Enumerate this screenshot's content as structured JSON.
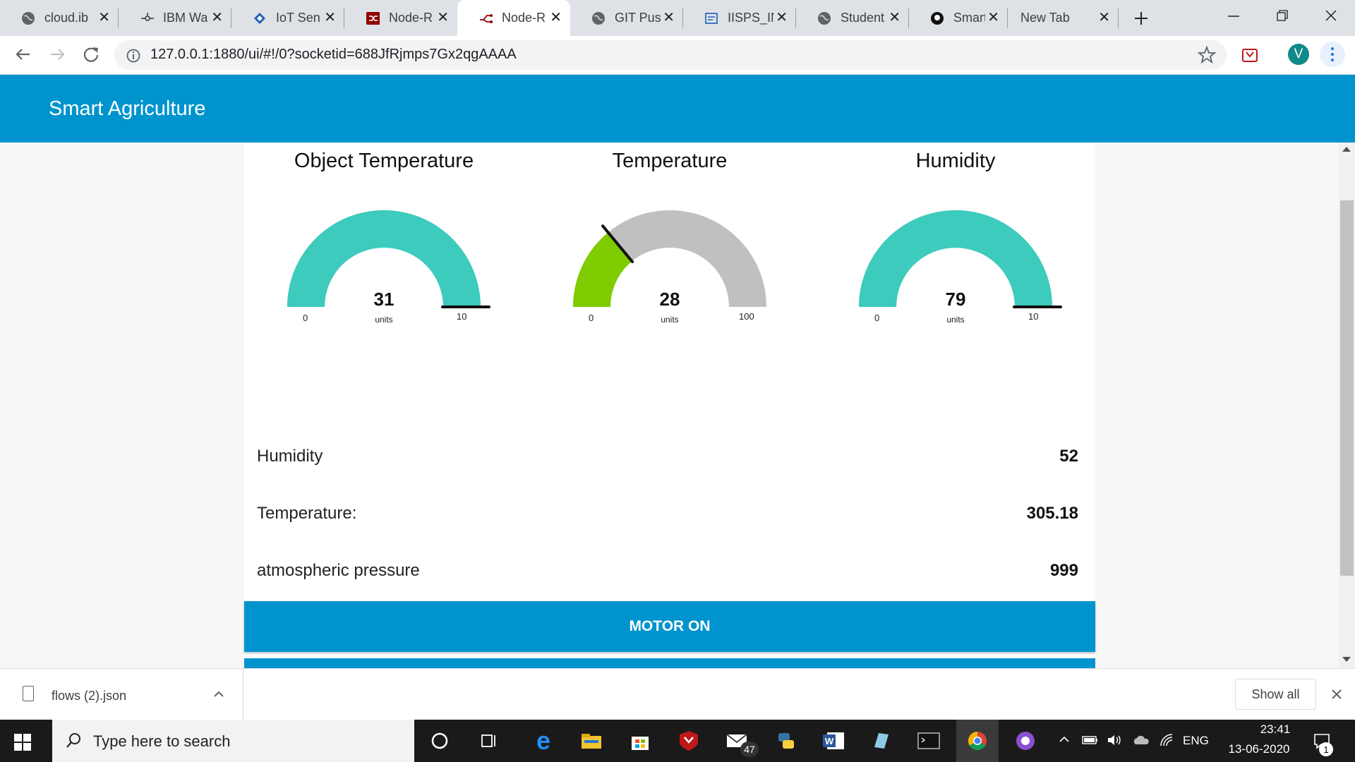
{
  "browser": {
    "tabs": [
      {
        "title": "cloud.ib",
        "icon": "globe-icon",
        "active": false
      },
      {
        "title": "IBM Wa",
        "icon": "watson-icon",
        "active": false
      },
      {
        "title": "IoT Sen",
        "icon": "iot-icon",
        "active": false
      },
      {
        "title": "Node-R",
        "icon": "nodered-icon",
        "active": false
      },
      {
        "title": "Node-R",
        "icon": "nodered-icon",
        "active": true
      },
      {
        "title": "GIT Pus",
        "icon": "globe-icon",
        "active": false
      },
      {
        "title": "IISPS_IN",
        "icon": "document-icon",
        "active": false
      },
      {
        "title": "Student",
        "icon": "globe-icon",
        "active": false
      },
      {
        "title": "SmartP",
        "icon": "github-icon",
        "active": false
      },
      {
        "title": "New Tab",
        "icon": "",
        "active": false
      }
    ],
    "url": "127.0.0.1:1880/ui/#!/0?socketid=688JfRjmps7Gx2qgAAAA",
    "profile_initial": "V"
  },
  "app": {
    "title": "Smart Agriculture"
  },
  "gauges": [
    {
      "title": "Object Temperature",
      "value": "31",
      "unit": "units",
      "min": "0",
      "max": "10",
      "fraction": 1.0,
      "fill_color": "#3ccbbd"
    },
    {
      "title": "Temperature",
      "value": "28",
      "unit": "units",
      "min": "0",
      "max": "100",
      "fraction": 0.28,
      "fill_color": "#7fcc00"
    },
    {
      "title": "Humidity",
      "value": "79",
      "unit": "units",
      "min": "0",
      "max": "10",
      "fraction": 1.0,
      "fill_color": "#3ccbbd"
    }
  ],
  "readings": [
    {
      "label": "Humidity",
      "value": "52"
    },
    {
      "label": "Temperature:",
      "value": "305.18"
    },
    {
      "label": "atmospheric pressure",
      "value": "999"
    }
  ],
  "motor_button": {
    "label": "MOTOR ON"
  },
  "downloads": {
    "file": "flows (2).json",
    "show_all": "Show all"
  },
  "taskbar": {
    "search_placeholder": "Type here to search",
    "mail_badge": "47",
    "language": "ENG",
    "time": "23:41",
    "date": "13-06-2020",
    "notification_count": "1"
  },
  "colors": {
    "accent": "#0094ce",
    "gauge_track": "#c0c0c0"
  }
}
